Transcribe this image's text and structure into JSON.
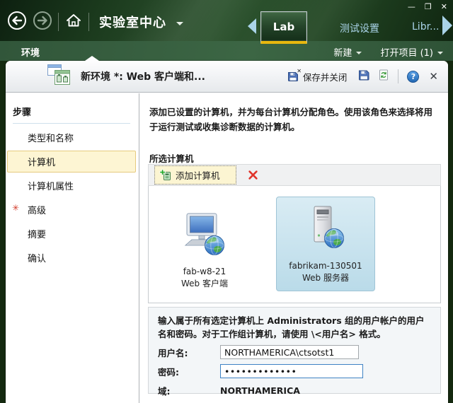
{
  "colors": {
    "brand_green": "#2e5430",
    "accent_gold": "#e8b70e",
    "tab_inactive_text": "#a9d3e8",
    "step_highlight_bg": "#fdf5d3",
    "selected_tile_bg": "#cde4ef",
    "required_red": "#d13b2a",
    "delete_red": "#e0352b",
    "focus_border_blue": "#3e82c4"
  },
  "window": {
    "minimize_glyph": "—",
    "maximize_glyph": "❐",
    "close_glyph": "✕",
    "nav_title": "实验室中心",
    "tabs": {
      "lab": "Lab",
      "test_settings": "测试设置",
      "library": "Libr..."
    },
    "ribbon": {
      "context_tab": "环境",
      "new_menu": "新建",
      "open_items": "打开项目 (1)"
    }
  },
  "dialog": {
    "title": "新环境 *: Web 客户端和...",
    "save_and_close": "保存并关闭",
    "close_glyph": "✕",
    "help_glyph": "?",
    "steps_header": "步骤",
    "required_marker": "✳",
    "steps": [
      "类型和名称",
      "计算机",
      "计算机属性",
      "高级",
      "摘要",
      "确认"
    ],
    "instruction": "添加已设置的计算机，并为每台计算机分配角色。使用该角色来选择将用于运行测试或收集诊断数据的计算机。",
    "selected_computers": "所选计算机",
    "add_computer": "添加计算机",
    "machines": [
      {
        "name": "fab-w8-21",
        "role": "Web 客户端"
      },
      {
        "name": "fabrikam-130501",
        "role": "Web 服务器"
      }
    ],
    "credentials": {
      "instruction": "输入属于所有选定计算机上 Administrators 组的用户帐户的用户名和密码。对于工作组计算机，请使用 \\<用户名> 格式。",
      "username_label": "用户名:",
      "username_value": "NORTHAMERICA\\ctsotst1",
      "password_label": "密码:",
      "password_value": "•••••••••••••",
      "domain_label": "域:",
      "domain_value": "NORTHAMERICA"
    }
  }
}
